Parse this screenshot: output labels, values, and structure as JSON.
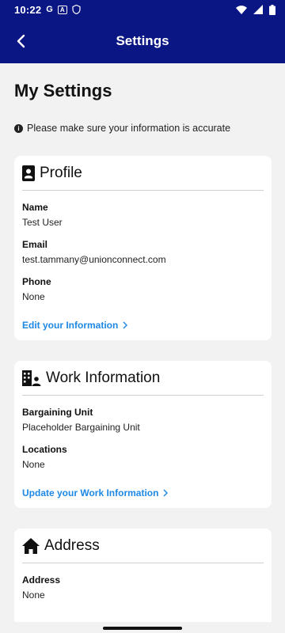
{
  "status_bar": {
    "time": "10:22",
    "left_icons": [
      "G",
      "A",
      "shield"
    ],
    "right_icons": [
      "wifi",
      "signal",
      "battery"
    ]
  },
  "app_bar": {
    "title": "Settings",
    "back_icon": "arrow-left"
  },
  "page": {
    "title": "My Settings",
    "notice": "Please make sure your information is accurate"
  },
  "profile_card": {
    "title": "Profile",
    "fields": [
      {
        "label": "Name",
        "value": "Test User"
      },
      {
        "label": "Email",
        "value": "test.tammany@unionconnect.com"
      },
      {
        "label": "Phone",
        "value": "None"
      }
    ],
    "link": "Edit your Information"
  },
  "work_card": {
    "title": "Work Information",
    "fields": [
      {
        "label": "Bargaining Unit",
        "value": "Placeholder Bargaining Unit"
      },
      {
        "label": "Locations",
        "value": "None"
      }
    ],
    "link": "Update your Work Information"
  },
  "address_card": {
    "title": "Address",
    "fields": [
      {
        "label": "Address",
        "value": "None"
      }
    ]
  },
  "colors": {
    "primary": "#0a1683",
    "link": "#1e88e5",
    "background": "#f2f2f2"
  }
}
